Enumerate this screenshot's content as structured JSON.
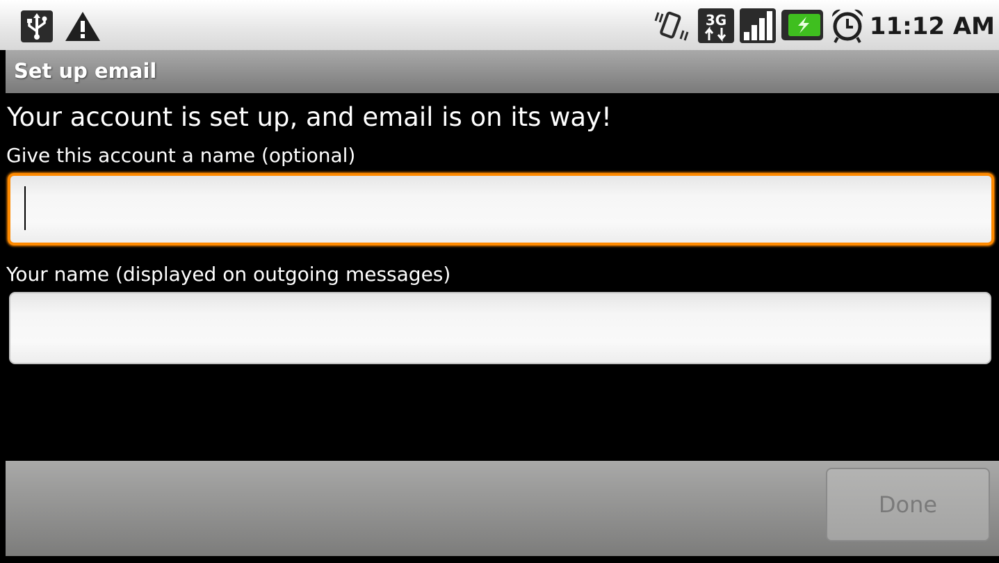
{
  "status_bar": {
    "time": "11:12 AM",
    "left_icons": [
      "usb-icon",
      "warning-icon"
    ],
    "right_icons": [
      "vibrate-icon",
      "network-3g-icon",
      "signal-strength-icon",
      "battery-charging-icon",
      "alarm-clock-icon"
    ],
    "battery_color": "#3fbf1f"
  },
  "title_bar": {
    "title": "Set up email"
  },
  "content": {
    "headline": "Your account is set up, and email is on its way!",
    "account_name_label": "Give this account a name (optional)",
    "account_name_value": "",
    "your_name_label": "Your name (displayed on outgoing messages)",
    "your_name_value": "",
    "focus_color": "#ff8a00"
  },
  "bottom_bar": {
    "done_label": "Done",
    "done_enabled": false
  }
}
